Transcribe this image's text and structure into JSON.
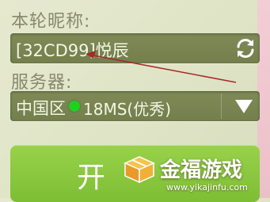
{
  "form": {
    "nickname_label": "本轮昵称:",
    "nickname_value": "[32CD99]悦辰",
    "server_label": "服务器:",
    "server_region": "中国区",
    "server_status": "18MS(优秀)",
    "enter_button_label": "开"
  },
  "colors": {
    "field_bg": "#7a8551",
    "status_good": "#1ed11e",
    "button_green": "#8cc63f",
    "annotation_arrow": "#a52a2a"
  },
  "icons": {
    "refresh": "refresh-icon",
    "dropdown": "triangle-down-icon",
    "watermark_logo": "gift-box-icon"
  },
  "watermark": {
    "title": "金福游戏",
    "url": "www.yikajinfu.com"
  }
}
